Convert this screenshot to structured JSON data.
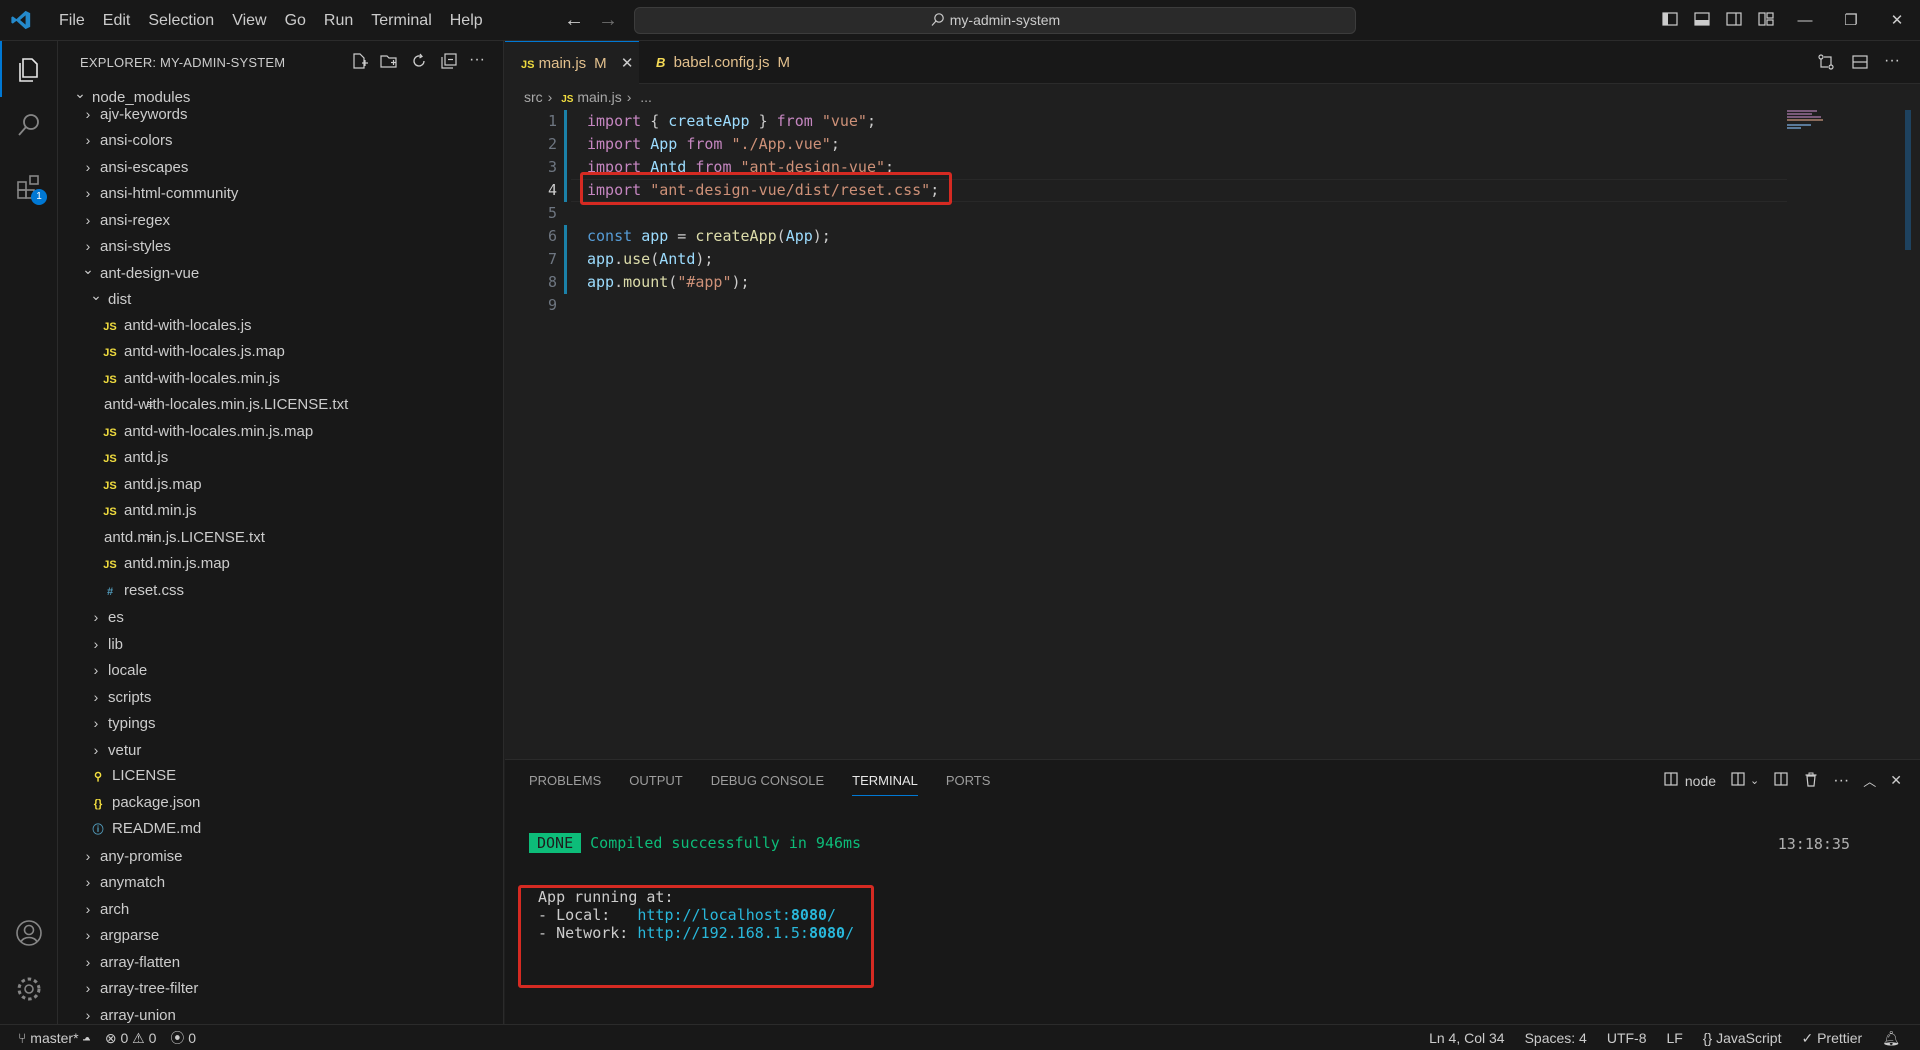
{
  "window": {
    "search_text": "my-admin-system",
    "menu": [
      "File",
      "Edit",
      "Selection",
      "View",
      "Go",
      "Run",
      "Terminal",
      "Help"
    ]
  },
  "activity": {
    "extensions_badge": "1"
  },
  "explorer": {
    "title": "EXPLORER: MY-ADMIN-SYSTEM",
    "tree": [
      {
        "label": "node_modules",
        "depth": 0,
        "kind": "folder-open"
      },
      {
        "label": "ajv-keywords",
        "depth": 1,
        "kind": "folder"
      },
      {
        "label": "ansi-colors",
        "depth": 1,
        "kind": "folder"
      },
      {
        "label": "ansi-escapes",
        "depth": 1,
        "kind": "folder"
      },
      {
        "label": "ansi-html-community",
        "depth": 1,
        "kind": "folder"
      },
      {
        "label": "ansi-regex",
        "depth": 1,
        "kind": "folder"
      },
      {
        "label": "ansi-styles",
        "depth": 1,
        "kind": "folder"
      },
      {
        "label": "ant-design-vue",
        "depth": 1,
        "kind": "folder-open"
      },
      {
        "label": "dist",
        "depth": 2,
        "kind": "folder-open"
      },
      {
        "label": "antd-with-locales.js",
        "depth": 3,
        "kind": "js"
      },
      {
        "label": "antd-with-locales.js.map",
        "depth": 3,
        "kind": "js"
      },
      {
        "label": "antd-with-locales.min.js",
        "depth": 3,
        "kind": "js"
      },
      {
        "label": "antd-with-locales.min.js.LICENSE.txt",
        "depth": 3,
        "kind": "txt"
      },
      {
        "label": "antd-with-locales.min.js.map",
        "depth": 3,
        "kind": "js"
      },
      {
        "label": "antd.js",
        "depth": 3,
        "kind": "js"
      },
      {
        "label": "antd.js.map",
        "depth": 3,
        "kind": "js"
      },
      {
        "label": "antd.min.js",
        "depth": 3,
        "kind": "js"
      },
      {
        "label": "antd.min.js.LICENSE.txt",
        "depth": 3,
        "kind": "txt"
      },
      {
        "label": "antd.min.js.map",
        "depth": 3,
        "kind": "js"
      },
      {
        "label": "reset.css",
        "depth": 3,
        "kind": "css"
      },
      {
        "label": "es",
        "depth": 2,
        "kind": "folder"
      },
      {
        "label": "lib",
        "depth": 2,
        "kind": "folder"
      },
      {
        "label": "locale",
        "depth": 2,
        "kind": "folder"
      },
      {
        "label": "scripts",
        "depth": 2,
        "kind": "folder"
      },
      {
        "label": "typings",
        "depth": 2,
        "kind": "folder"
      },
      {
        "label": "vetur",
        "depth": 2,
        "kind": "folder"
      },
      {
        "label": "LICENSE",
        "depth": 2,
        "kind": "lic"
      },
      {
        "label": "package.json",
        "depth": 2,
        "kind": "json"
      },
      {
        "label": "README.md",
        "depth": 2,
        "kind": "info"
      },
      {
        "label": "any-promise",
        "depth": 1,
        "kind": "folder"
      },
      {
        "label": "anymatch",
        "depth": 1,
        "kind": "folder"
      },
      {
        "label": "arch",
        "depth": 1,
        "kind": "folder"
      },
      {
        "label": "argparse",
        "depth": 1,
        "kind": "folder"
      },
      {
        "label": "array-flatten",
        "depth": 1,
        "kind": "folder"
      },
      {
        "label": "array-tree-filter",
        "depth": 1,
        "kind": "folder"
      },
      {
        "label": "array-union",
        "depth": 1,
        "kind": "folder"
      }
    ]
  },
  "tabs": [
    {
      "name": "main.js",
      "status": "M",
      "icon": "JS"
    },
    {
      "name": "babel.config.js",
      "status": "M",
      "icon": "B"
    }
  ],
  "breadcrumb": {
    "folder": "src",
    "file": "main.js",
    "more": "..."
  },
  "code": {
    "line_numbers": [
      "1",
      "2",
      "3",
      "4",
      "5",
      "6",
      "7",
      "8",
      "9"
    ],
    "current_line": 4
  },
  "panel": {
    "tabs": [
      "PROBLEMS",
      "OUTPUT",
      "DEBUG CONSOLE",
      "TERMINAL",
      "PORTS"
    ],
    "active_tab": "TERMINAL",
    "shell": "node",
    "done_label": "DONE",
    "compiled": "Compiled successfully in 946ms",
    "timestamp": "13:18:35",
    "running": "App running at:",
    "local_label": "- Local:   ",
    "local_url": "http://localhost:",
    "local_port": "8080",
    "network_label": "- Network: ",
    "network_url": "http://192.168.1.5:",
    "network_port": "8080",
    "slash": "/"
  },
  "statusbar": {
    "branch": "master*",
    "errors": "0",
    "warnings": "0",
    "ports": "0",
    "position": "Ln 4, Col 34",
    "spaces": "Spaces: 4",
    "encoding": "UTF-8",
    "eol": "LF",
    "language": "JavaScript",
    "formatter": "Prettier"
  }
}
